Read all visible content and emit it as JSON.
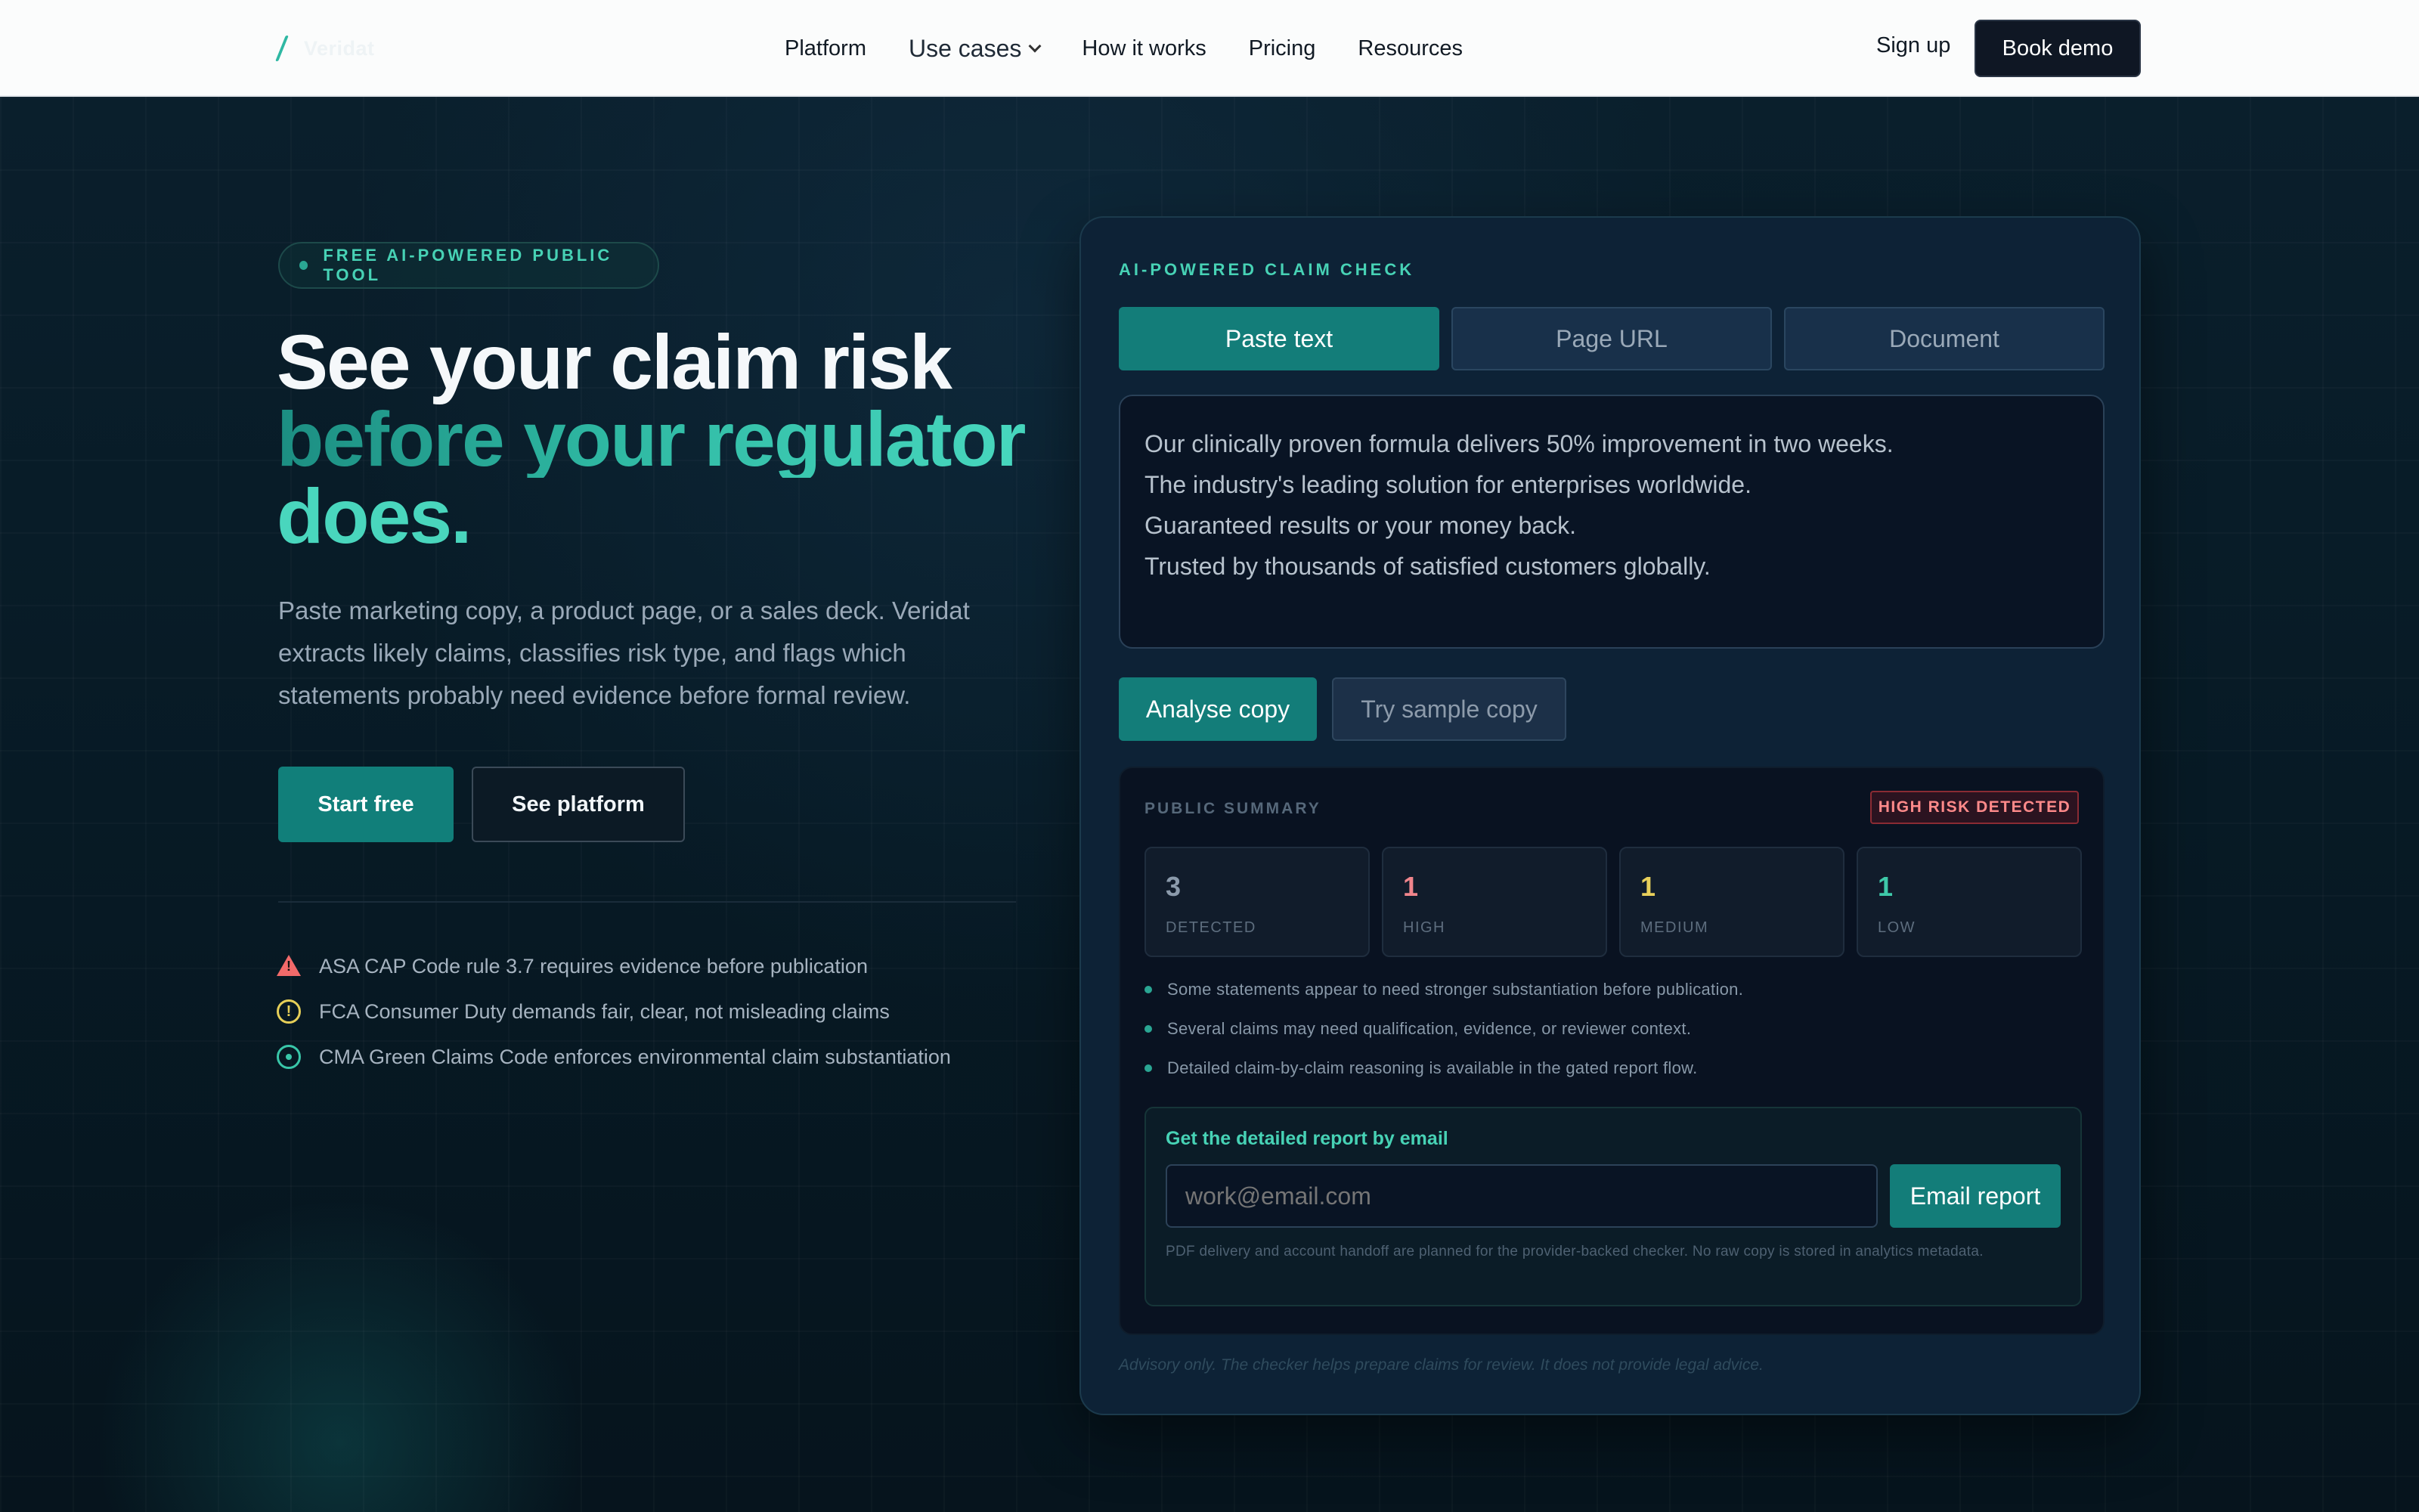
{
  "nav": {
    "logo_text": "Veridat",
    "links": [
      "Platform",
      "Use cases",
      "How it works",
      "Pricing",
      "Resources"
    ],
    "signup": "Sign up",
    "book_demo": "Book demo"
  },
  "hero": {
    "pill": "FREE AI-POWERED PUBLIC TOOL",
    "title_line1": "See your claim risk",
    "title_line2": "before your regulator",
    "title_line3": "does.",
    "lead": "Paste marketing copy, a product page, or a sales deck. Veridat extracts likely claims, classifies risk type, and flags which statements probably need evidence before formal review.",
    "start_free": "Start free",
    "see_platform": "See platform",
    "regulations": [
      {
        "icon": "warning-triangle-icon",
        "text": "ASA CAP Code rule 3.7 requires evidence before publication"
      },
      {
        "icon": "alert-circle-icon",
        "text": "FCA Consumer Duty demands fair, clear, not misleading claims"
      },
      {
        "icon": "check-circle-icon",
        "text": "CMA Green Claims Code enforces environmental claim substantiation"
      }
    ]
  },
  "checker": {
    "eyebrow": "AI-POWERED CLAIM CHECK",
    "tabs": [
      "Paste text",
      "Page URL",
      "Document"
    ],
    "active_tab": "Paste text",
    "copy_lines": [
      "Our clinically proven formula delivers 50% improvement in two weeks.",
      "The industry's leading solution for enterprises worldwide.",
      "Guaranteed results or your money back.",
      "Trusted by thousands of satisfied customers globally."
    ],
    "analyse_button": "Analyse copy",
    "sample_button": "Try sample copy",
    "summary": {
      "title": "PUBLIC SUMMARY",
      "badge": "HIGH RISK DETECTED",
      "stats": [
        {
          "value": "3",
          "label": "DETECTED",
          "color": "#8b9aab"
        },
        {
          "value": "1",
          "label": "HIGH",
          "color": "#f0858c"
        },
        {
          "value": "1",
          "label": "MEDIUM",
          "color": "#e8cf5a"
        },
        {
          "value": "1",
          "label": "LOW",
          "color": "#3ec9a9"
        }
      ],
      "bullets": [
        "Some statements appear to need stronger substantiation before publication.",
        "Several claims may need qualification, evidence, or reviewer context.",
        "Detailed claim-by-claim reasoning is available in the gated report flow."
      ]
    },
    "email": {
      "title": "Get the detailed report by email",
      "placeholder": "work@email.com",
      "button": "Email report",
      "note": "PDF delivery and account handoff are planned for the provider-backed checker. No raw copy is stored in analytics metadata."
    },
    "advisory": "Advisory only. The checker helps prepare claims for review. It does not provide legal advice."
  }
}
